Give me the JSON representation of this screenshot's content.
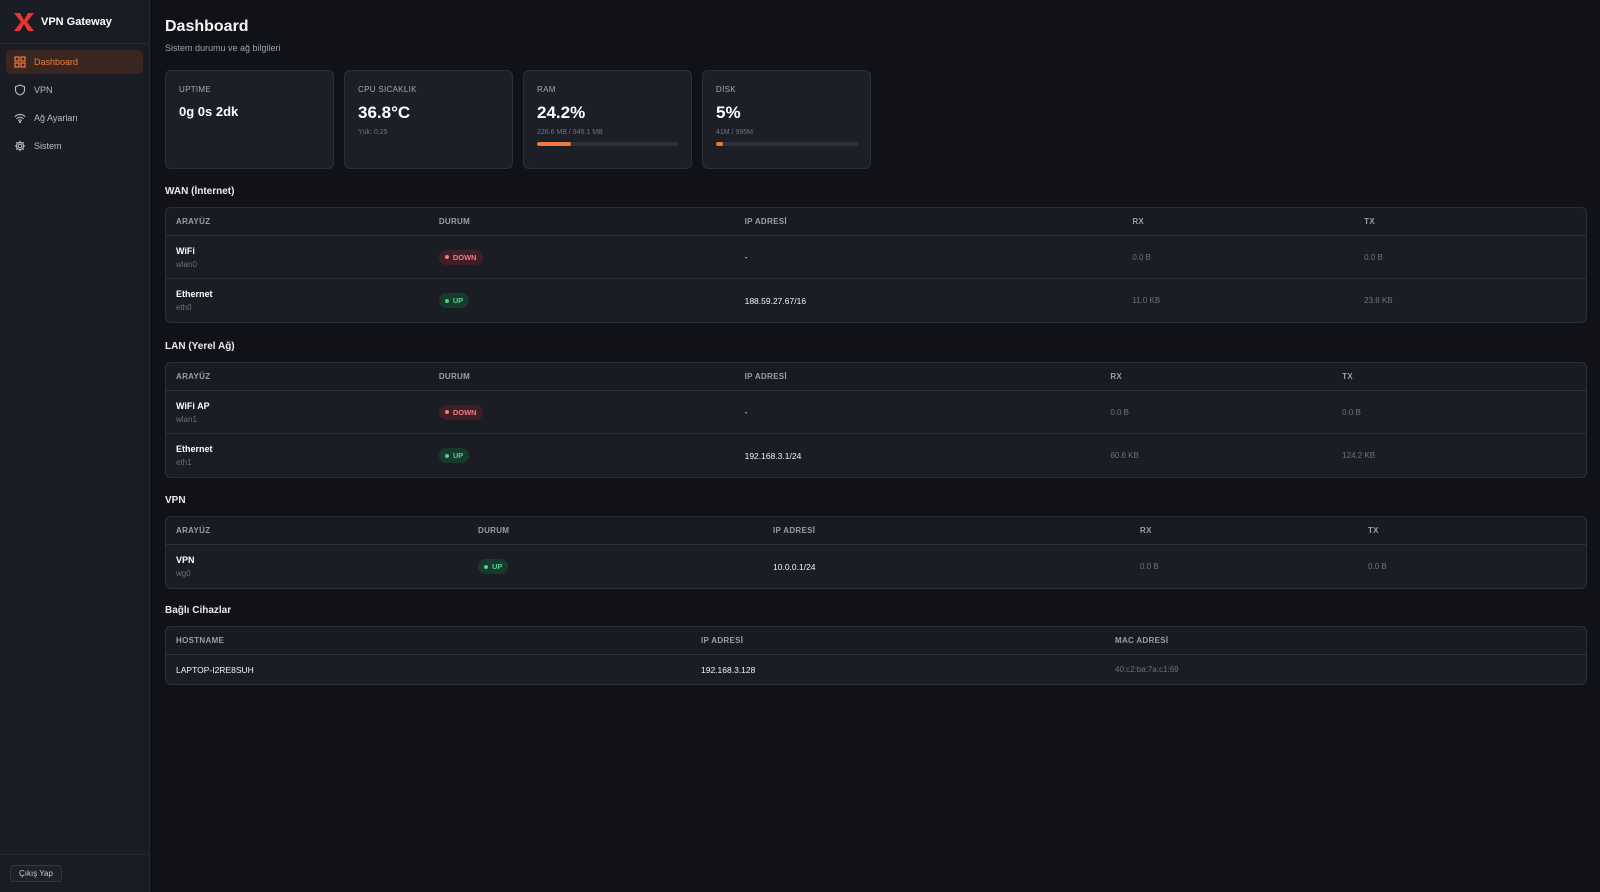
{
  "app": {
    "name": "VPN Gateway",
    "logo": "x-logo",
    "accent": "#f07a3a"
  },
  "sidebar": {
    "items": [
      {
        "label": "Dashboard",
        "icon": "grid-icon",
        "active": true
      },
      {
        "label": "VPN",
        "icon": "shield-icon",
        "active": false
      },
      {
        "label": "Ağ Ayarları",
        "icon": "wifi-icon",
        "active": false
      },
      {
        "label": "Sistem",
        "icon": "gear-icon",
        "active": false
      }
    ],
    "logout_label": "Çıkış Yap"
  },
  "page": {
    "title": "Dashboard",
    "subtitle": "Sistem durumu ve ağ bilgileri"
  },
  "cards": {
    "uptime": {
      "label": "UPTIME",
      "value": "0g 0s 2dk"
    },
    "cpu": {
      "label": "CPU SICAKLIK",
      "value": "36.8°C",
      "sub": "Yük: 0.25"
    },
    "ram": {
      "label": "RAM",
      "value": "24.2%",
      "sub": "228.6 MB / 946.1 MB",
      "percent": 24.2
    },
    "disk": {
      "label": "DİSK",
      "value": "5%",
      "sub": "41M / 995M",
      "percent": 5
    }
  },
  "wan": {
    "title": "WAN (İnternet)",
    "headers": [
      "ARAYÜZ",
      "DURUM",
      "IP ADRESİ",
      "RX",
      "TX"
    ],
    "rows": [
      {
        "name": "WiFi",
        "dev": "wlan0",
        "status": "DOWN",
        "ip": "-",
        "rx": "0.0 B",
        "tx": "0.0 B"
      },
      {
        "name": "Ethernet",
        "dev": "eth0",
        "status": "UP",
        "ip": "188.59.27.67/16",
        "rx": "11.0 KB",
        "tx": "23.8 KB"
      }
    ]
  },
  "lan": {
    "title": "LAN (Yerel Ağ)",
    "headers": [
      "ARAYÜZ",
      "DURUM",
      "IP ADRESİ",
      "RX",
      "TX"
    ],
    "rows": [
      {
        "name": "WiFi AP",
        "dev": "wlan1",
        "status": "DOWN",
        "ip": "-",
        "rx": "0.0 B",
        "tx": "0.0 B"
      },
      {
        "name": "Ethernet",
        "dev": "eth1",
        "status": "UP",
        "ip": "192.168.3.1/24",
        "rx": "60.6 KB",
        "tx": "124.2 KB"
      }
    ]
  },
  "vpn": {
    "title": "VPN",
    "headers": [
      "ARAYÜZ",
      "DURUM",
      "IP ADRESİ",
      "RX",
      "TX"
    ],
    "rows": [
      {
        "name": "VPN",
        "dev": "wg0",
        "status": "UP",
        "ip": "10.0.0.1/24",
        "rx": "0.0 B",
        "tx": "0.0 B"
      }
    ]
  },
  "devices": {
    "title": "Bağlı Cihazlar",
    "headers": [
      "HOSTNAME",
      "IP ADRESİ",
      "MAC ADRESİ"
    ],
    "rows": [
      {
        "hostname": "LAPTOP-I2RE8SUH",
        "ip": "192.168.3.128",
        "mac": "40:c2:ba:7a:c1:69"
      }
    ]
  }
}
